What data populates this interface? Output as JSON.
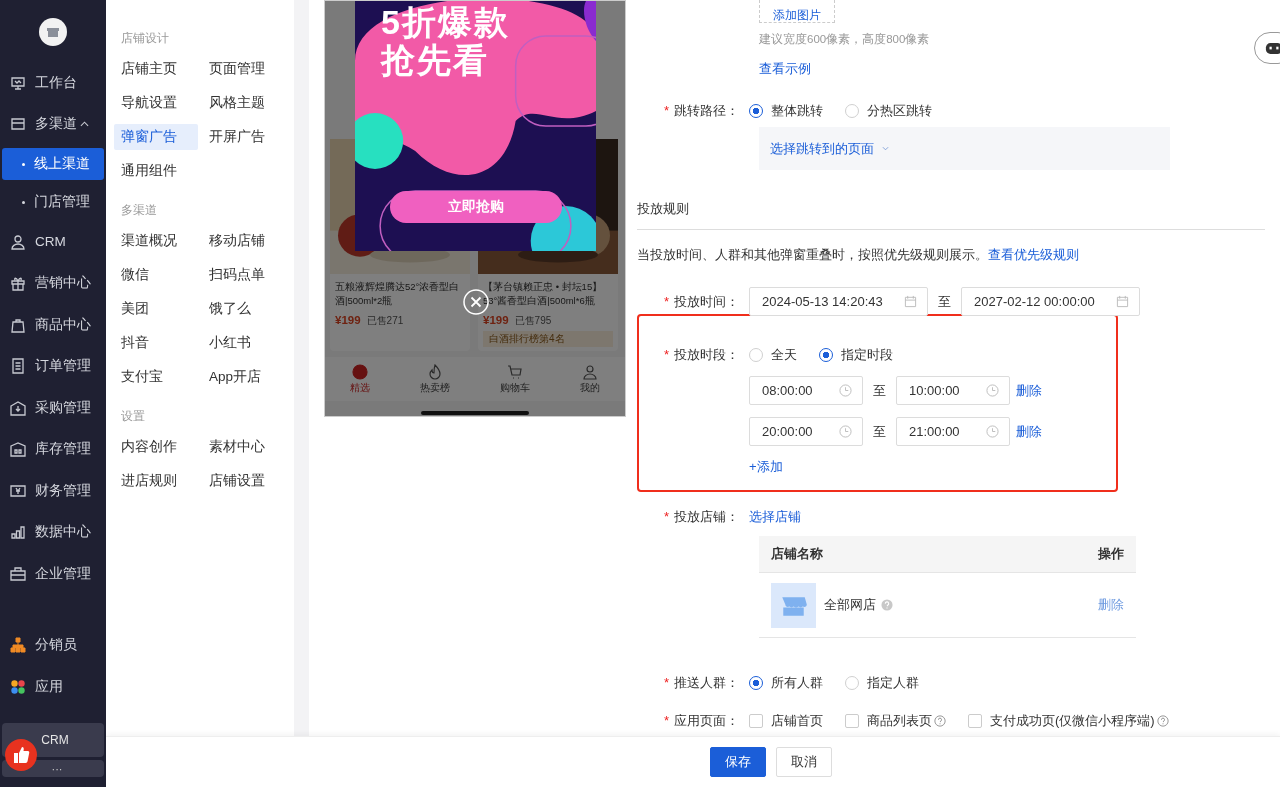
{
  "sidebar": {
    "items": [
      {
        "label": "工作台",
        "selected": false
      },
      {
        "label": "多渠道",
        "selected": false,
        "expanded": true,
        "children": [
          {
            "label": "线上渠道",
            "selected": true
          },
          {
            "label": "门店管理",
            "selected": false
          }
        ]
      },
      {
        "label": "CRM",
        "selected": false
      },
      {
        "label": "营销中心",
        "selected": false
      },
      {
        "label": "商品中心",
        "selected": false
      },
      {
        "label": "订单管理",
        "selected": false
      },
      {
        "label": "采购管理",
        "selected": false
      },
      {
        "label": "库存管理",
        "selected": false
      },
      {
        "label": "财务管理",
        "selected": false
      },
      {
        "label": "数据中心",
        "selected": false
      },
      {
        "label": "企业管理",
        "selected": false
      }
    ],
    "bottom_items": [
      {
        "label": "分销员"
      },
      {
        "label": "应用"
      }
    ],
    "account": {
      "label": "CRM",
      "more": "···"
    }
  },
  "submenu": [
    {
      "title": "店铺设计",
      "items": [
        {
          "label": "店铺主页",
          "selected": false
        },
        {
          "label": "页面管理",
          "selected": false
        },
        {
          "label": "导航设置",
          "selected": false
        },
        {
          "label": "风格主题",
          "selected": false
        },
        {
          "label": "弹窗广告",
          "selected": true
        },
        {
          "label": "开屏广告",
          "selected": false
        },
        {
          "label": "通用组件",
          "selected": false
        }
      ]
    },
    {
      "title": "多渠道",
      "items": [
        {
          "label": "渠道概况",
          "selected": false
        },
        {
          "label": "移动店铺",
          "selected": false
        },
        {
          "label": "微信",
          "selected": false
        },
        {
          "label": "扫码点单",
          "selected": false
        },
        {
          "label": "美团",
          "selected": false
        },
        {
          "label": "饿了么",
          "selected": false
        },
        {
          "label": "抖音",
          "selected": false
        },
        {
          "label": "小红书",
          "selected": false
        },
        {
          "label": "支付宝",
          "selected": false
        },
        {
          "label": "App开店",
          "selected": false
        }
      ]
    },
    {
      "title": "设置",
      "items": [
        {
          "label": "内容创作",
          "selected": false
        },
        {
          "label": "素材中心",
          "selected": false
        },
        {
          "label": "进店规则",
          "selected": false
        },
        {
          "label": "店铺设置",
          "selected": false
        }
      ]
    }
  ],
  "preview": {
    "ad": {
      "headline": [
        "5折爆款",
        "抢先看"
      ],
      "button": "立即抢购"
    },
    "products": [
      {
        "title": "五粮液辉煌腾达52°浓香型白酒|500ml*2瓶",
        "price": "¥199",
        "sold": "已售271"
      },
      {
        "title": "【茅台镇赖正忠 • 封坛15】53°酱香型白酒|500ml*6瓶",
        "price": "¥199",
        "sold": "已售795",
        "rank": "白酒排行榜第4名"
      }
    ],
    "tabs": [
      {
        "label": "精选",
        "selected": true
      },
      {
        "label": "热卖榜",
        "selected": false
      },
      {
        "label": "购物车",
        "selected": false
      },
      {
        "label": "我的",
        "selected": false
      }
    ]
  },
  "form": {
    "upload": {
      "button": "添加图片",
      "hint": "建议宽度600像素，高度800像素",
      "example_link": "查看示例"
    },
    "jump": {
      "label": "跳转路径：",
      "mark": "*",
      "options": [
        {
          "label": "整体跳转",
          "selected": true
        },
        {
          "label": "分热区跳转",
          "selected": false
        }
      ],
      "page_select": "选择跳转到的页面"
    },
    "section_title": "投放规则",
    "notice": {
      "text": "当投放时间、人群和其他弹窗重叠时，按照优先级规则展示。",
      "link": "查看优先级规则"
    },
    "time": {
      "label": "投放时间：",
      "mark": "*",
      "start": "2024-05-13 14:20:43",
      "separator": "至",
      "end": "2027-02-12 00:00:00"
    },
    "period": {
      "label": "投放时段：",
      "mark": "*",
      "highlighted": true,
      "options": [
        {
          "label": "全天",
          "selected": false
        },
        {
          "label": "指定时段",
          "selected": true
        }
      ],
      "ranges": [
        {
          "start": "08:00:00",
          "separator": "至",
          "end": "10:00:00",
          "delete": "删除"
        },
        {
          "start": "20:00:00",
          "separator": "至",
          "end": "21:00:00",
          "delete": "删除"
        }
      ],
      "add": "+添加"
    },
    "store": {
      "label": "投放店铺：",
      "mark": "*",
      "link": "选择店铺",
      "columns": [
        "店铺名称",
        "操作"
      ],
      "rows": [
        {
          "name": "全部网店",
          "action": "删除"
        }
      ]
    },
    "audience": {
      "label": "推送人群：",
      "mark": "*",
      "options": [
        {
          "label": "所有人群",
          "selected": true
        },
        {
          "label": "指定人群",
          "selected": false
        }
      ]
    },
    "pages": {
      "label": "应用页面：",
      "mark": "*",
      "options": [
        {
          "label": "店铺首页",
          "checked": false,
          "help": false
        },
        {
          "label": "商品列表页",
          "checked": false,
          "help": true
        },
        {
          "label": "支付成功页(仅微信小程序端)",
          "checked": false,
          "help": true
        }
      ]
    }
  },
  "footer": {
    "save": "保存",
    "cancel": "取消"
  }
}
